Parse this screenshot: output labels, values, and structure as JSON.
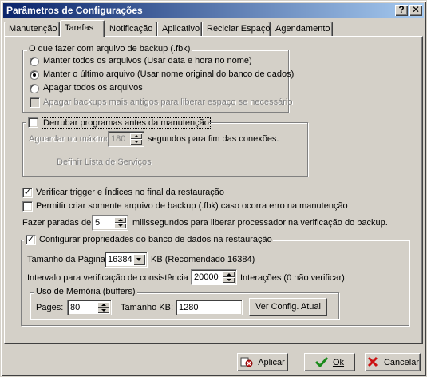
{
  "window": {
    "title": "Parâmetros de Configurações",
    "help_glyph": "?",
    "close_glyph": "✕"
  },
  "tabs": [
    {
      "label": "Manutenção",
      "active": false
    },
    {
      "label": "Tarefas",
      "active": true
    },
    {
      "label": "Notificação",
      "active": false
    },
    {
      "label": "Aplicativo",
      "active": false
    },
    {
      "label": "Reciclar Espaço",
      "active": false
    },
    {
      "label": "Agendamento",
      "active": false
    }
  ],
  "backup_group": {
    "legend": "O que fazer com arquivo de backup (.fbk)",
    "options": [
      {
        "label": "Manter todos os arquivos (Usar data e hora no nome)",
        "selected": false
      },
      {
        "label": "Manter o último arquivo (Usar nome original do banco de dados)",
        "selected": true
      },
      {
        "label": "Apagar todos os arquivos",
        "selected": false
      }
    ],
    "delete_old_label": "Apagar backups mais antigos para liberar espaço se necessário",
    "delete_old_checked": false
  },
  "kill_programs": {
    "label": "Derrubar programas antes da manutenção",
    "checked": false,
    "wait_label": "Aguardar no máximo",
    "wait_value": "180",
    "wait_suffix": "segundos para fim das conexões.",
    "services_label": "Definir Lista de Serviços"
  },
  "options": {
    "verify_trigger_label": "Verificar trigger e Índices no final da restauração",
    "verify_trigger_checked": true,
    "allow_backup_only_label": "Permitir criar somente arquivo de backup (.fbk) caso ocorra erro na manutenção",
    "allow_backup_only_checked": false,
    "pause_label": "Fazer paradas de",
    "pause_value": "5",
    "pause_suffix": "milissegundos para liberar processador na verificação do backup."
  },
  "db_props": {
    "label": "Configurar propriedades do banco de dados na restauração",
    "checked": true,
    "page_size_label": "Tamanho da Página",
    "page_size_value": "16384",
    "page_size_suffix": "KB (Recomendado 16384)",
    "interval_label": "Intervalo para verificação de consistência",
    "interval_value": "20000",
    "interval_suffix": "Interações (0 não verificar)",
    "memory": {
      "legend": "Uso de Memória (buffers)",
      "pages_label": "Pages:",
      "pages_value": "80",
      "size_label": "Tamanho KB:",
      "size_value": "1280",
      "view_button": "Ver Config. Atual"
    }
  },
  "footer": {
    "apply": "Aplicar",
    "ok": "Ok",
    "cancel": "Cancelar"
  }
}
